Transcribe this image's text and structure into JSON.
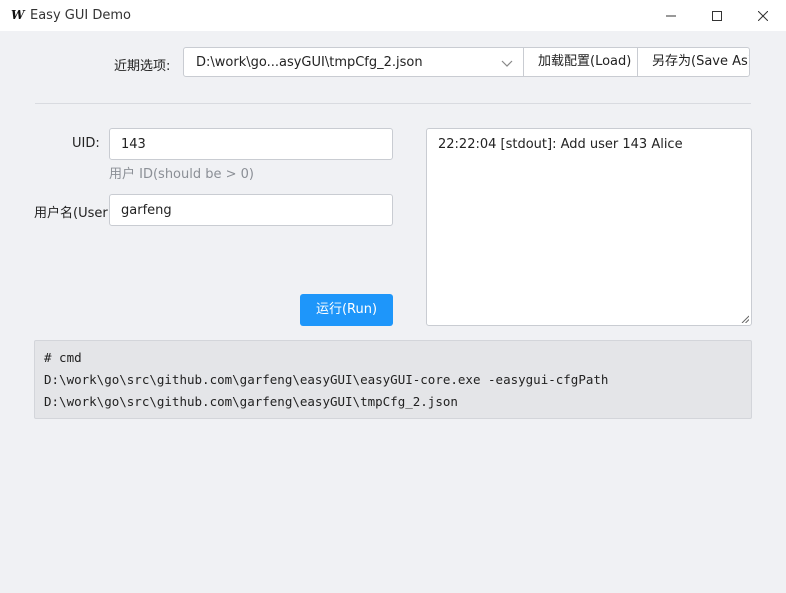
{
  "window": {
    "title": "Easy GUI Demo",
    "app_icon": "W"
  },
  "recent": {
    "label": "近期选项:",
    "selected": "D:\\work\\go...asyGUI\\tmpCfg_2.json",
    "load_label": "加载配置(Load)",
    "saveas_label": "另存为(Save As)"
  },
  "form": {
    "uid_label": "UID:",
    "uid_value": "143",
    "uid_help": "用户 ID(should be > 0)",
    "user_label": "用户名(User",
    "user_value": "garfeng",
    "run_label": "运行(Run)"
  },
  "output": {
    "text": "22:22:04 [stdout]: Add user 143 Alice"
  },
  "cmd": {
    "line1": "# cmd",
    "line2": "D:\\work\\go\\src\\github.com\\garfeng\\easyGUI\\easyGUI-core.exe -easygui-cfgPath",
    "line3": "D:\\work\\go\\src\\github.com\\garfeng\\easyGUI\\tmpCfg_2.json"
  },
  "colors": {
    "accent": "#1e96fa",
    "background": "#f0f1f4",
    "cmd_background": "#e4e5e8"
  }
}
